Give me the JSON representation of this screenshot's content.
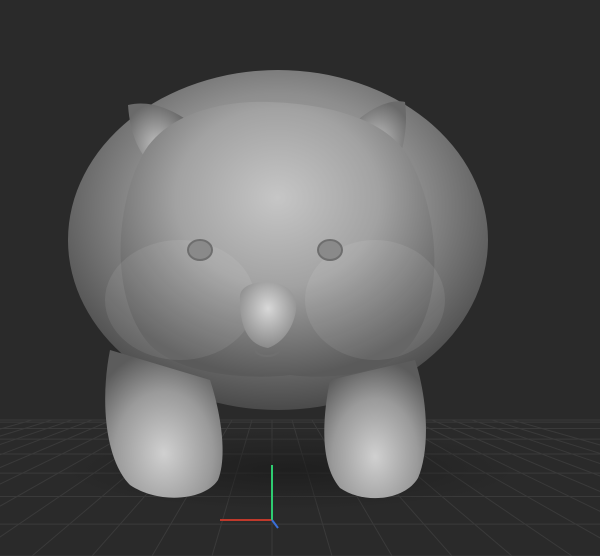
{
  "viewport": {
    "background_color": "#2a2a2a",
    "grid_color": "#3a3a3a",
    "model_color": "#8f8f8f",
    "axis_colors": {
      "x": "#c0392b",
      "y": "#2ecc71",
      "z": "#3a6fd8"
    }
  },
  "model": {
    "subject": "wombat",
    "material": "matcap-grey"
  }
}
